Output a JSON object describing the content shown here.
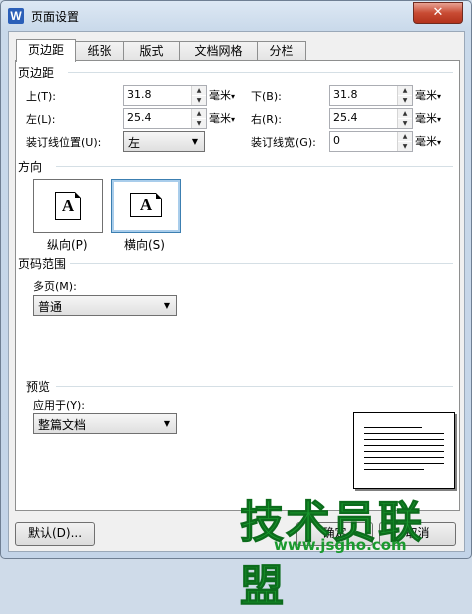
{
  "window": {
    "title": "页面设置",
    "app_icon": "W",
    "close_glyph": "✕"
  },
  "tabs": [
    {
      "label": "页边距",
      "active": true
    },
    {
      "label": "纸张",
      "active": false
    },
    {
      "label": "版式",
      "active": false
    },
    {
      "label": "文档网格",
      "active": false
    },
    {
      "label": "分栏",
      "active": false
    }
  ],
  "margins": {
    "group_title": "页边距",
    "top_label": "上(T):",
    "top_value": "31.8",
    "bottom_label": "下(B):",
    "bottom_value": "31.8",
    "left_label": "左(L):",
    "left_value": "25.4",
    "right_label": "右(R):",
    "right_value": "25.4",
    "gutter_pos_label": "装订线位置(U):",
    "gutter_pos_value": "左",
    "gutter_label": "装订线宽(G):",
    "gutter_value": "0",
    "unit": "毫米"
  },
  "orientation": {
    "group_title": "方向",
    "portrait_label": "纵向(P)",
    "landscape_label": "横向(S)",
    "selected": "landscape",
    "icon_letter": "A"
  },
  "page_range": {
    "group_title": "页码范围",
    "multi_label": "多页(M):",
    "multi_value": "普通"
  },
  "preview": {
    "group_title": "预览",
    "apply_label": "应用于(Y):",
    "apply_value": "整篇文档"
  },
  "buttons": {
    "default": "默认(D)...",
    "ok": "确定",
    "cancel": "取消"
  },
  "watermark": {
    "text": "技术员联盟",
    "url": "www.jsgho.com"
  },
  "colors": {
    "selected_border": "#3c7fb1",
    "watermark": "#1a9a2e",
    "close": "#c84b33"
  }
}
